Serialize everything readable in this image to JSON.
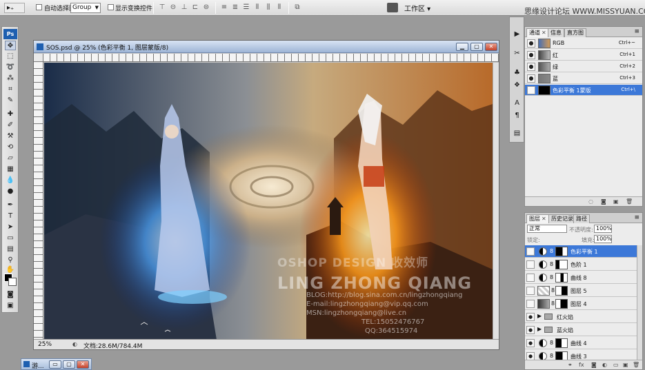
{
  "options_bar": {
    "tool_preset": "▸₊",
    "auto_select_label": "自动选择图层",
    "auto_select_value": "Group",
    "show_transform_label": "显示变换控件",
    "workspace_label": "工作区 ▾"
  },
  "site_watermark": "思缘设计论坛 WWW.MISSYUAN.COM",
  "toolbox": {
    "logo": "Ps",
    "tools": [
      "move",
      "marquee",
      "lasso",
      "magic-wand",
      "crop",
      "eyedropper",
      "healing",
      "brush",
      "clone-stamp",
      "history-brush",
      "eraser",
      "gradient",
      "blur",
      "dodge",
      "pen",
      "type",
      "path-select",
      "shape",
      "notes",
      "eyedropper-2",
      "hand",
      "zoom",
      "quick-mask",
      "screen-mode"
    ]
  },
  "document": {
    "title": "SOS.psd @ 25% (色彩平衡 1, 图层蒙版/8)",
    "zoom": "25%",
    "doc_size": "文档:28.6M/784.4M",
    "watermark_line1": "OSHOP DESIGN 收效师",
    "watermark_line2": "LING ZHONG QIANG",
    "watermark_lines": [
      "BLOG:http://blog.sina.com.cn/lingzhongqiang",
      "E-mail:lingzhongqiang@vip.qq.com",
      "MSN:lingzhongqiang@live.cn",
      "TEL:15052476767",
      "QQ:364515974"
    ]
  },
  "channels_panel": {
    "tabs": [
      "通道",
      "信息",
      "直方图"
    ],
    "rows": [
      {
        "name": "RGB",
        "shortcut": "Ctrl+~",
        "selected": false
      },
      {
        "name": "红",
        "shortcut": "Ctrl+1",
        "selected": false
      },
      {
        "name": "绿",
        "shortcut": "Ctrl+2",
        "selected": false
      },
      {
        "name": "蓝",
        "shortcut": "Ctrl+3",
        "selected": false
      },
      {
        "name": "色彩平衡 1蒙版",
        "shortcut": "Ctrl+\\",
        "selected": true
      }
    ]
  },
  "layers_panel": {
    "tabs": [
      "图层",
      "历史记录",
      "路径"
    ],
    "blend_mode": "正常",
    "opacity_label": "不透明度:",
    "opacity": "100%",
    "lock_label": "锁定:",
    "fill_label": "填充:",
    "fill": "100%",
    "rows": [
      {
        "name": "色彩平衡 1",
        "kind": "adjustment",
        "selected": true
      },
      {
        "name": "色阶 1",
        "kind": "adjustment",
        "selected": false
      },
      {
        "name": "曲线 8",
        "kind": "adjustment",
        "selected": false
      },
      {
        "name": "图层 5",
        "kind": "pixel",
        "selected": false
      },
      {
        "name": "图层 4",
        "kind": "pixel",
        "selected": false
      },
      {
        "name": "红火焰",
        "kind": "group",
        "selected": false
      },
      {
        "name": "蓝火焰",
        "kind": "group",
        "selected": false
      },
      {
        "name": "曲线 4",
        "kind": "adjustment",
        "selected": false
      },
      {
        "name": "曲线 3",
        "kind": "adjustment",
        "selected": false
      }
    ]
  },
  "mini_window": {
    "title": "游..."
  }
}
